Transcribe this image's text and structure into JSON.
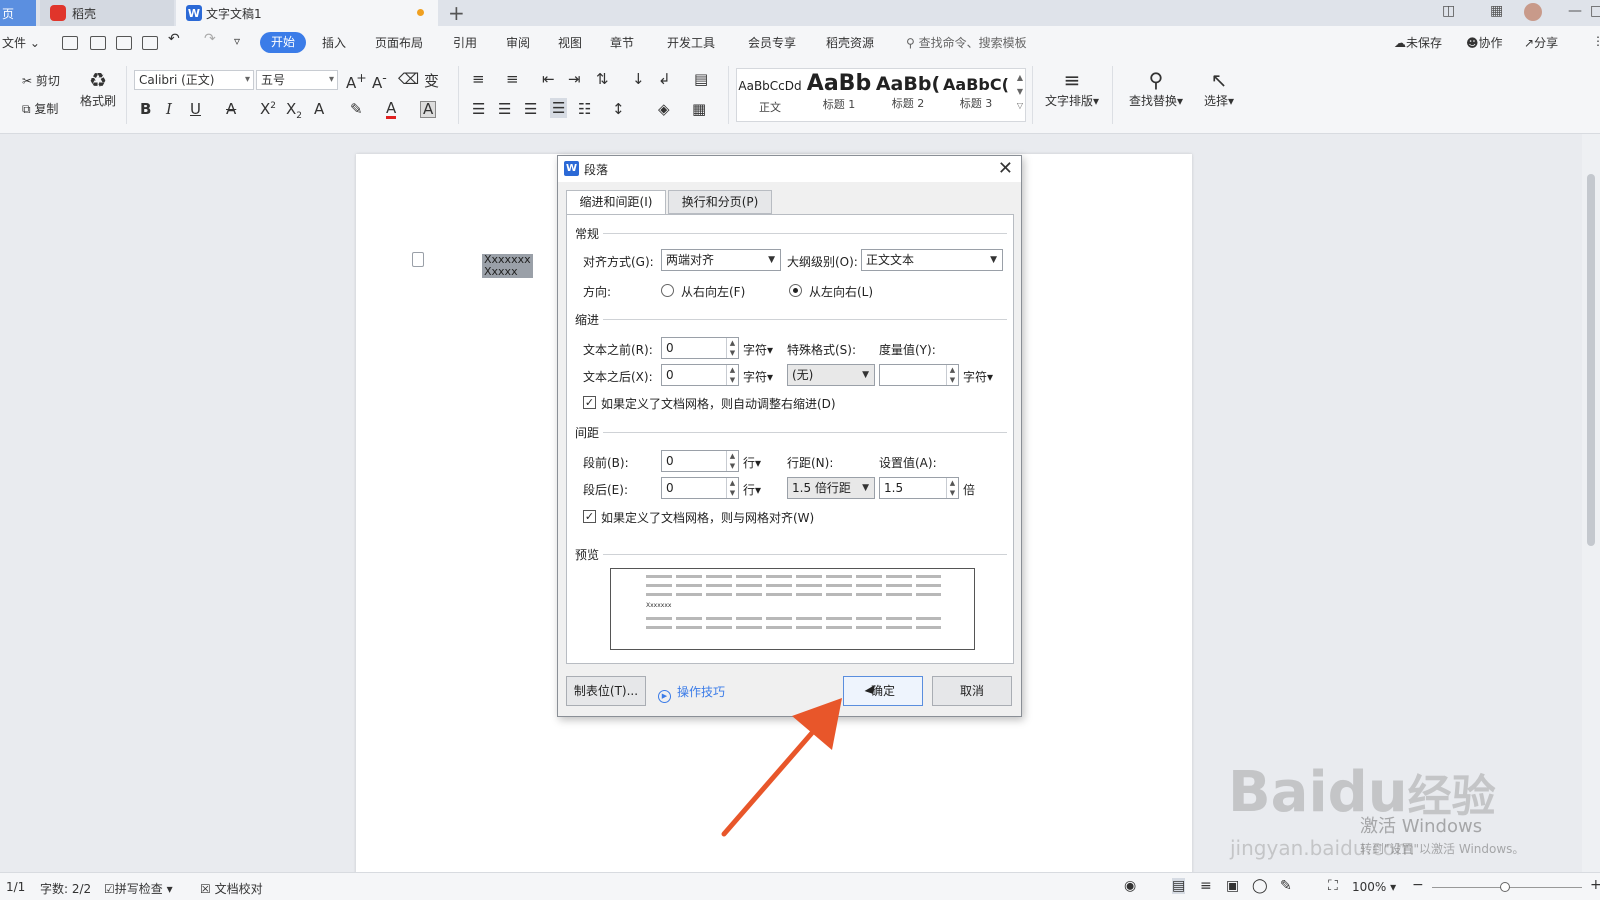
{
  "titlebar": {
    "home_tab": "页",
    "daoke_tab": "稻壳",
    "doc_tab": "文字文稿1",
    "doc_icon": "W",
    "new_tab": "+"
  },
  "menubar": {
    "file": "文件",
    "items": [
      "开始",
      "插入",
      "页面布局",
      "引用",
      "审阅",
      "视图",
      "章节",
      "开发工具",
      "会员专享",
      "稻壳资源"
    ],
    "search_placeholder": "查找命令、搜索模板",
    "unsaved": "未保存",
    "collab": "协作",
    "share": "分享"
  },
  "ribbon": {
    "cut": "剪切",
    "copy": "复制",
    "format_painter": "格式刷",
    "font_name": "Calibri (正文)",
    "font_size": "五号",
    "styles": [
      {
        "preview": "AaBbCcDd",
        "name": "正文"
      },
      {
        "preview": "AaBb",
        "name": "标题 1"
      },
      {
        "preview": "AaBb(",
        "name": "标题 2"
      },
      {
        "preview": "AaBbC(",
        "name": "标题 3"
      }
    ],
    "text_layout": "文字排版",
    "find_replace": "查找替换",
    "select": "选择"
  },
  "document": {
    "line1": "Xxxxxxx",
    "line2": "Xxxxx"
  },
  "dialog": {
    "title": "段落",
    "tabs": [
      "缩进和间距(I)",
      "换行和分页(P)"
    ],
    "general": {
      "title": "常规",
      "align_label": "对齐方式(G):",
      "align_value": "两端对齐",
      "outline_label": "大纲级别(O):",
      "outline_value": "正文文本",
      "direction_label": "方向:",
      "rtl": "从右向左(F)",
      "ltr": "从左向右(L)"
    },
    "indent": {
      "title": "缩进",
      "before_label": "文本之前(R):",
      "before_value": "0",
      "before_unit": "字符",
      "after_label": "文本之后(X):",
      "after_value": "0",
      "after_unit": "字符",
      "special_label": "特殊格式(S):",
      "special_value": "(无)",
      "measure_label": "度量值(Y):",
      "measure_value": "",
      "measure_unit": "字符",
      "auto_adjust": "如果定义了文档网格，则自动调整右缩进(D)"
    },
    "spacing": {
      "title": "间距",
      "before_label": "段前(B):",
      "before_value": "0",
      "before_unit": "行",
      "after_label": "段后(E):",
      "after_value": "0",
      "after_unit": "行",
      "line_label": "行距(N):",
      "line_value": "1.5 倍行距",
      "set_label": "设置值(A):",
      "set_value": "1.5",
      "set_unit": "倍",
      "snap_grid": "如果定义了文档网格，则与网格对齐(W)"
    },
    "preview_title": "预览",
    "preview_sample": "Xxxxxxx",
    "tabs_button": "制表位(T)...",
    "tips": "操作技巧",
    "ok": "确定",
    "cancel": "取消"
  },
  "statusbar": {
    "page": "1/1",
    "word_count": "字数: 2/2",
    "spell_check": "拼写检查",
    "proofread": "文档校对",
    "zoom": "100%"
  },
  "watermark": {
    "brand": "Bai",
    "brand2": "du",
    "jingyan": "经验",
    "url": "jingyan.baidu.com",
    "activate": "激活 Windows",
    "activate_sub": "转到\"设置\"以激活 Windows。"
  },
  "colors": {
    "accent": "#3b7ce8",
    "arrow": "#e8562a",
    "doc_icon": "#2b69d6"
  }
}
